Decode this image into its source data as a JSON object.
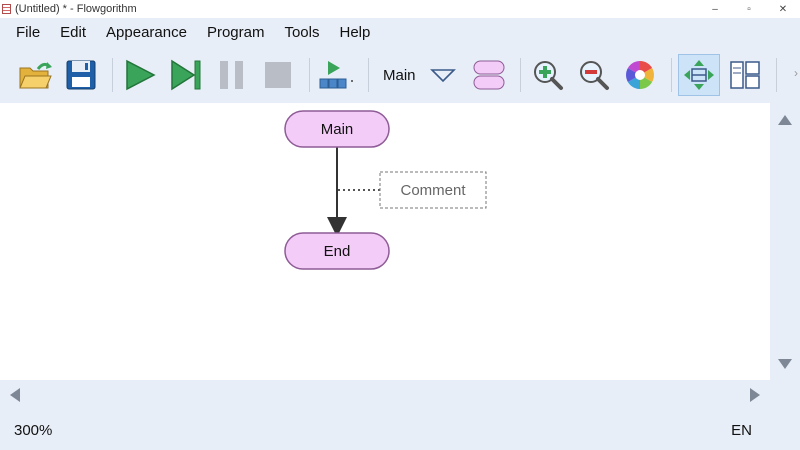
{
  "window": {
    "title": "(Untitled) * - Flowgorithm",
    "minimize": "–",
    "maximize": "▫",
    "close": "✕"
  },
  "menu": {
    "items": [
      {
        "label": "File"
      },
      {
        "label": "Edit"
      },
      {
        "label": "Appearance"
      },
      {
        "label": "Program"
      },
      {
        "label": "Tools"
      },
      {
        "label": "Help"
      }
    ]
  },
  "toolbar": {
    "function_selector": "Main",
    "more_indicator": "›"
  },
  "flowchart": {
    "start_label": "Main",
    "end_label": "End",
    "comment_label": "Comment"
  },
  "status": {
    "zoom": "300%",
    "language": "EN"
  },
  "colors": {
    "terminal_fill": "#f3ccf8",
    "terminal_stroke": "#8e5c96",
    "play_green": "#3aa55a",
    "selection_blue": "#cde3f7"
  }
}
